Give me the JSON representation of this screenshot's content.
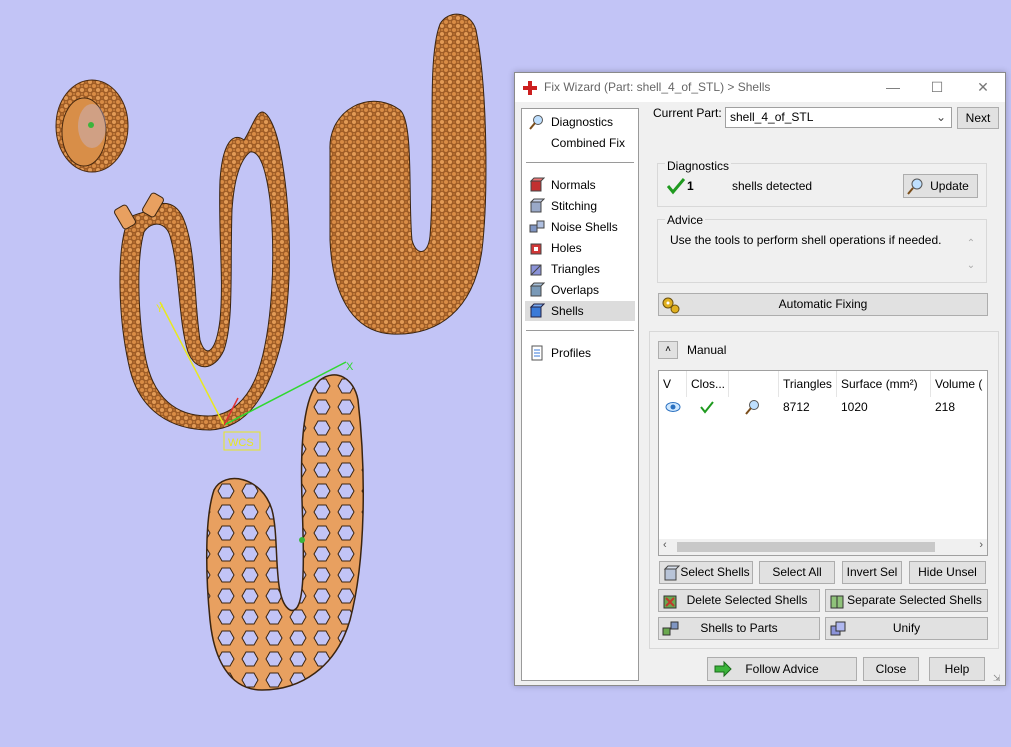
{
  "window": {
    "title": "Fix Wizard (Part: shell_4_of_STL) > Shells"
  },
  "nav": {
    "items": [
      "Diagnostics",
      "Combined Fix",
      "Normals",
      "Stitching",
      "Noise Shells",
      "Holes",
      "Triangles",
      "Overlaps",
      "Shells",
      "Profiles"
    ],
    "selected": "Shells"
  },
  "current_part": {
    "label": "Current Part:",
    "value": "shell_4_of_STL",
    "next": "Next"
  },
  "diagnostics": {
    "title": "Diagnostics",
    "count": "1",
    "text": "shells detected",
    "update": "Update"
  },
  "advice": {
    "title": "Advice",
    "text": "Use the tools to perform shell operations if needed."
  },
  "automatic_fixing": "Automatic Fixing",
  "manual": {
    "title": "Manual",
    "columns": [
      "V",
      "Clos...",
      "",
      "Triangles",
      "Surface (mm²)",
      "Volume ("
    ],
    "rows": [
      {
        "triangles": "8712",
        "surface": "1020",
        "volume": "218"
      }
    ]
  },
  "buttons": {
    "select_shells": "Select Shells",
    "select_all": "Select All",
    "invert_sel": "Invert Sel",
    "hide_unsel": "Hide Unsel",
    "delete_selected": "Delete Selected Shells",
    "separate_selected": "Separate Selected Shells",
    "shells_to_parts": "Shells to Parts",
    "unify": "Unify",
    "follow_advice": "Follow Advice",
    "close": "Close",
    "help": "Help"
  },
  "viewport": {
    "wcs_label": "WCS",
    "x_axis": "X",
    "y_axis": "Y"
  },
  "colors": {
    "background": "#c2c4f6",
    "model": "#e8a060",
    "accent_green": "#1f9a1f"
  }
}
